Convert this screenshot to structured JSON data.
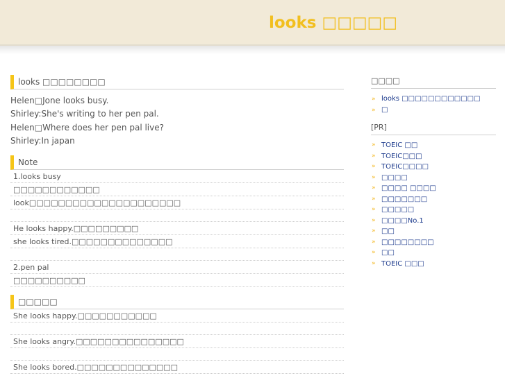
{
  "header": {
    "title": "looks □□□□□"
  },
  "main": {
    "article_heading": "looks □□□□□□□□",
    "dialog": [
      "Helen□Jone looks busy.",
      "Shirley:She's writing to her pen pal.",
      "Helen□Where does her pen pal live?",
      "Shirley:In japan"
    ],
    "note_heading": "Note",
    "note_rows": [
      "1.looks busy",
      "□□□□□□□□□□□□",
      "look□□□□□□□□□□□□□□□□□□□□□",
      "",
      "He looks happy.□□□□□□□□□",
      "she looks tired.□□□□□□□□□□□□□□",
      "",
      "2.pen pal",
      "□□□□□□□□□□"
    ],
    "example_heading": "□□□□□",
    "example_rows": [
      "She looks happy.□□□□□□□□□□□",
      "",
      "She looks angry.□□□□□□□□□□□□□□□",
      "",
      "She looks bored.□□□□□□□□□□□□□□"
    ]
  },
  "sidebar": {
    "heading": "□□□□",
    "links": [
      "looks □□□□□□□□□□□□",
      "□"
    ],
    "pr_heading": "[PR]",
    "pr_links": [
      "TOEIC □□",
      "TOEIC□□□",
      "TOEIC□□□□",
      "□□□□",
      "□□□□ □□□□",
      "□□□□□□□",
      "□□□□□",
      "□□□□No.1",
      "□□",
      "□□□□□□□□",
      "□□",
      "TOEIC □□□"
    ]
  },
  "colors": {
    "header_bg": "#f2ead8",
    "title": "#f2bf1f",
    "accent_bar": "#f5c518",
    "link": "#1c3a8c",
    "arrow": "#f2b51a"
  },
  "icons": {
    "list_bullet": "double-chevron-right-icon"
  }
}
